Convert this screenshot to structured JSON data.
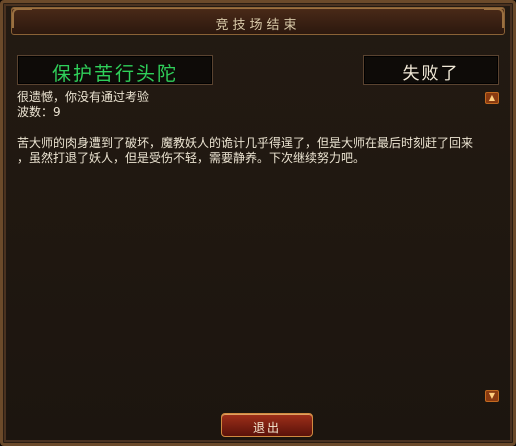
{
  "window": {
    "title": "竞技场结束"
  },
  "mission": {
    "name": "保护苦行头陀"
  },
  "result": {
    "status": "失败了"
  },
  "message": {
    "line1": "很遗憾，你没有通过考验",
    "line2": "波数：9",
    "line3": "苦大师的肉身遭到了破坏，魔教妖人的诡计几乎得逞了，但是大师在最后时刻赶了回来",
    "line4": "，虽然打退了妖人，但是受伤不轻，需要静养。下次继续努力吧。"
  },
  "buttons": {
    "exit": "退出"
  },
  "colors": {
    "mission_green": "#2fd05a",
    "exit_red": "#a0301a",
    "frame_gold": "#9a7040"
  },
  "icons": {
    "scroll_up": "up-arrow-icon",
    "scroll_down": "down-arrow-icon"
  }
}
